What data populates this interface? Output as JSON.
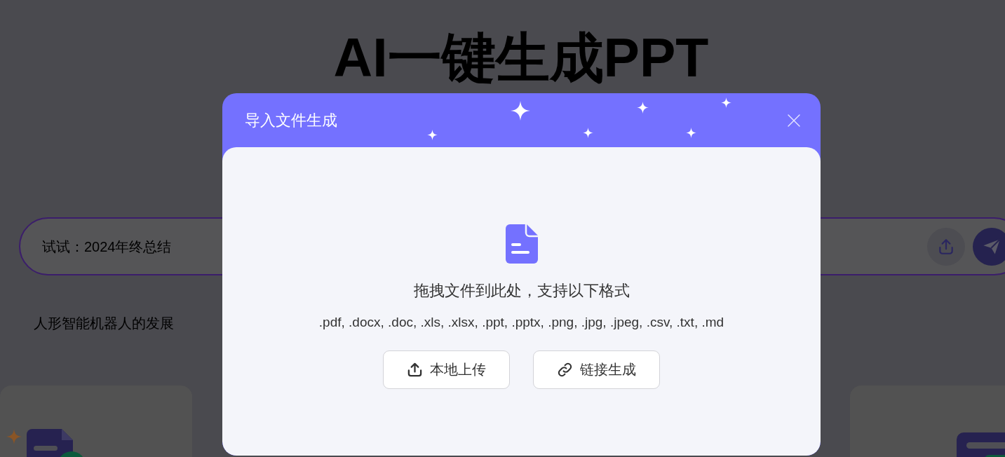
{
  "page": {
    "title": "AI一键生成PPT",
    "search": {
      "placeholder": "试试：2024年终总结"
    },
    "suggestions": [
      "人形智能机器人的发展"
    ]
  },
  "dialog": {
    "title": "导入文件生成",
    "drop_hint": "拖拽文件到此处，支持以下格式",
    "formats": ".pdf, .docx, .doc, .xls, .xlsx, .ppt, .pptx, .png, .jpg, .jpeg, .csv, .txt, .md",
    "buttons": [
      {
        "label": "本地上传",
        "kind": "upload"
      },
      {
        "label": "链接生成",
        "kind": "link"
      }
    ]
  }
}
